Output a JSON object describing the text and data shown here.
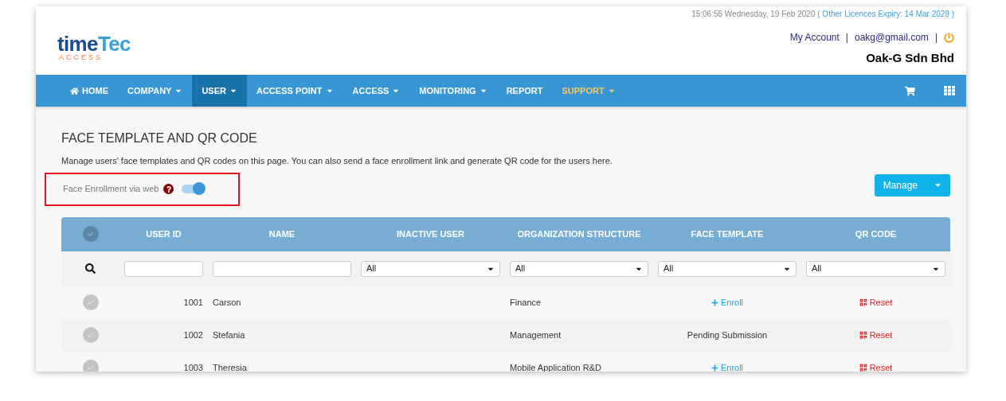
{
  "header": {
    "datetime": "15:06:55 Wednesday, 19 Feb 2020",
    "licence_note": "( Other Licences Expiry: 14 Mar 2029 )",
    "links": [
      "My Account",
      "oakg@gmail.com"
    ],
    "separators": [
      "|",
      "|"
    ],
    "company": "Oak-G Sdn Bhd",
    "logo": {
      "word_a": "time",
      "word_b": "Tec",
      "sub": "ACCESS"
    }
  },
  "nav": [
    {
      "label": "HOME",
      "kind": "home",
      "caret": false,
      "selected": false
    },
    {
      "label": "COMPANY",
      "kind": "plain",
      "caret": true,
      "selected": false
    },
    {
      "label": "USER",
      "kind": "plain",
      "caret": true,
      "selected": true
    },
    {
      "label": "ACCESS POINT",
      "kind": "plain",
      "caret": true,
      "selected": false
    },
    {
      "label": "ACCESS",
      "kind": "plain",
      "caret": true,
      "selected": false
    },
    {
      "label": "MONITORING",
      "kind": "plain",
      "caret": true,
      "selected": false
    },
    {
      "label": "REPORT",
      "kind": "plain",
      "caret": false,
      "selected": false
    },
    {
      "label": "SUPPORT",
      "kind": "support",
      "caret": true,
      "selected": false
    }
  ],
  "page": {
    "title": "FACE TEMPLATE AND QR CODE",
    "description": "Manage users' face templates and QR codes on this page. You can also send a face enrollment link and generate QR code for the users here.",
    "enrollment_toggle": {
      "label": "Face Enrollment via web",
      "on": true,
      "highlighted": true
    },
    "manage_button": "Manage"
  },
  "table": {
    "all_selected": false,
    "columns": [
      "USER ID",
      "NAME",
      "INACTIVE USER",
      "ORGANIZATION STRUCTURE",
      "FACE TEMPLATE",
      "QR CODE"
    ],
    "filters": [
      {
        "kind": "text"
      },
      {
        "kind": "text"
      },
      {
        "kind": "select",
        "value": "All"
      },
      {
        "kind": "select",
        "value": "All"
      },
      {
        "kind": "select",
        "value": "All"
      },
      {
        "kind": "select",
        "value": "All"
      }
    ],
    "rows": [
      {
        "selected": false,
        "user_id": "1001",
        "name": "Carson",
        "org": "Finance",
        "face": {
          "kind": "enroll",
          "text": "Enroll"
        },
        "qr": "Reset"
      },
      {
        "selected": false,
        "user_id": "1002",
        "name": "Stefania",
        "org": "Management",
        "face": {
          "kind": "status",
          "text": "Pending Submission"
        },
        "qr": "Reset"
      },
      {
        "selected": false,
        "user_id": "1003",
        "name": "Theresia",
        "org": "Mobile Application R&D",
        "face": {
          "kind": "enroll",
          "text": "Enroll"
        },
        "qr": "Reset"
      }
    ]
  }
}
